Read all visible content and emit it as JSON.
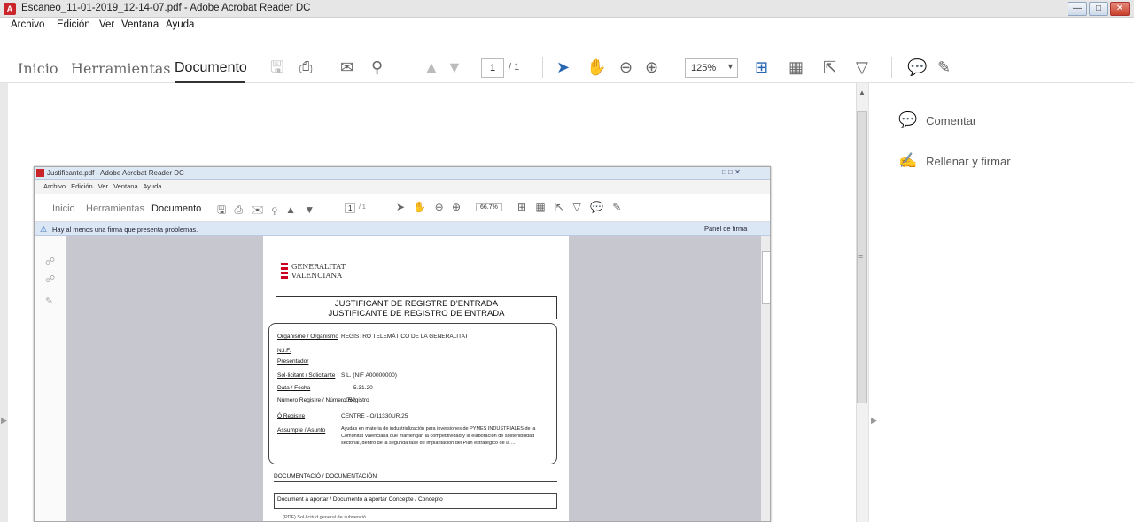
{
  "window": {
    "title": "Escaneo_11-01-2019_12-14-07.pdf - Adobe Acrobat Reader DC",
    "app_icon": "acrobat-icon",
    "buttons": [
      "minimize",
      "maximize",
      "close"
    ]
  },
  "menu": [
    "Archivo",
    "Edición",
    "Ver",
    "Ventana",
    "Ayuda"
  ],
  "tabs": [
    "Inicio",
    "Herramientas",
    "Documento"
  ],
  "active_tab": "Documento",
  "toolbar": {
    "page_current": "1",
    "page_total": "/ 1",
    "zoom": "125%",
    "icons": [
      "save-icon",
      "print-icon",
      "email-icon",
      "search-icon",
      "prev-page-icon",
      "next-page-icon",
      "select-arrow-icon",
      "hand-icon",
      "zoom-out-icon",
      "zoom-in-icon",
      "fit-page-icon",
      "scroll-mode-icon",
      "full-screen-icon",
      "read-mode-icon",
      "comment-icon",
      "pen-icon"
    ]
  },
  "right_panel": {
    "items": [
      {
        "label": "Comentar",
        "icon": "comment-icon",
        "color": "#f2b619"
      },
      {
        "label": "Rellenar y firmar",
        "icon": "sign-pen-icon",
        "color": "#7a66c2"
      }
    ]
  },
  "scanned": {
    "title": "Justificante.pdf - Adobe Acrobat Reader DC",
    "menu": "Archivo Edición Ver Ventana Ayuda",
    "tabs": [
      "Inicio",
      "Herramientas",
      "Documento"
    ],
    "page_current": "1",
    "page_total": "/ 1",
    "zoom": "66.7%",
    "banner": "Hay al menos una firma que presenta problemas.",
    "panel_button": "Panel de firma",
    "logo_line1": "GENERALITAT",
    "logo_line2": "VALENCIANA",
    "heading1": "JUSTIFICANT DE REGISTRE D'ENTRADA",
    "heading2": "JUSTIFICANTE DE REGISTRO DE ENTRADA",
    "fields": [
      {
        "label": "Organisme / Organismo",
        "value": "REGISTRO TELEMÁTICO DE LA GENERALITAT"
      },
      {
        "label": "N.I.F.",
        "value": ""
      },
      {
        "label": "Presentador",
        "value": ""
      },
      {
        "label": "Sol·licitant / Solicitante",
        "value": "S.L. (NIF A00000000)"
      },
      {
        "label": "Data / Fecha",
        "value": "5.31.20"
      },
      {
        "label": "Número Registre / Número Registro",
        "value": "...052"
      },
      {
        "label": "Ó Registre",
        "value": "CENTRE - O/11330UR.25"
      },
      {
        "label": "Assumpte / Asunto",
        "value": "Ayudas en materia de industrialización para inversiones de PYMES INDUSTRIALES de la Comunitat Valenciana que mantengan la competitividad y la elaboración de sostenibilidad sectorial, dentro de la segunda fase de implantación del Plan estratégico de la ..."
      }
    ],
    "doc_heading": "DOCUMENTACIÓ / DOCUMENTACIÓN",
    "doc_box": "Document a aportar / Documento a aportar      Concepte / Concepto",
    "doc_line": "... (PDF) Sol·licitud general de subvenció"
  }
}
